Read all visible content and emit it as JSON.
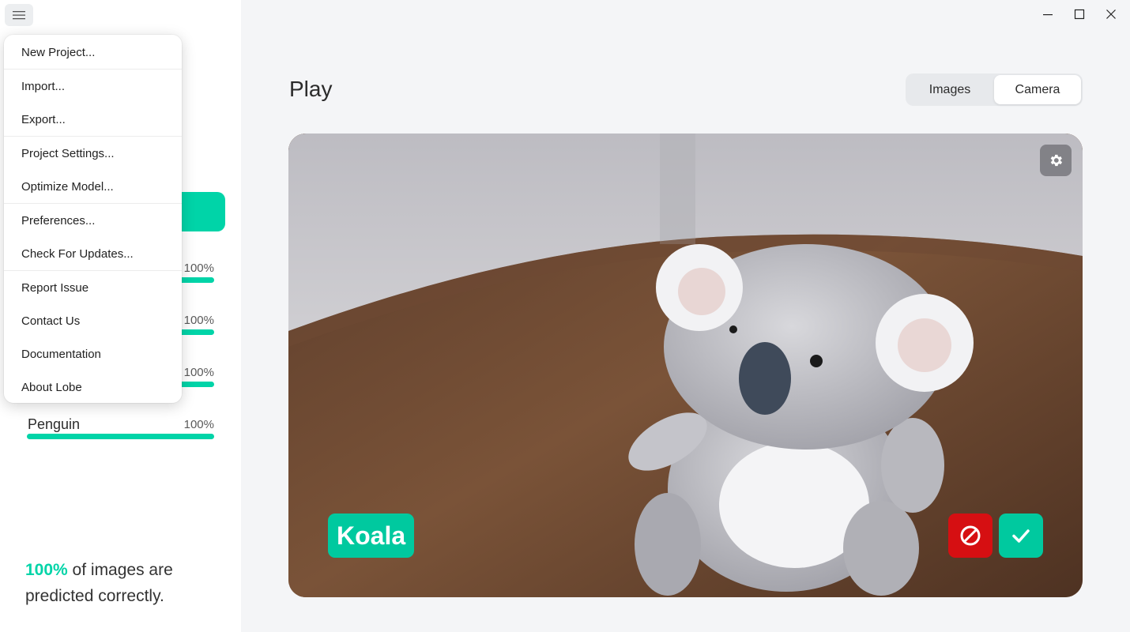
{
  "sidebar": {
    "labels": [
      {
        "name": "",
        "percent": "100%",
        "fill": 1.0
      },
      {
        "name": "",
        "percent": "100%",
        "fill": 1.0
      },
      {
        "name": "",
        "percent": "100%",
        "fill": 1.0
      },
      {
        "name": "Penguin",
        "percent": "100%",
        "fill": 1.0
      }
    ],
    "summary": {
      "percent": "100%",
      "line1_rest": " of images are",
      "line2": "predicted correctly."
    }
  },
  "menu": {
    "items": [
      {
        "label": "New Project..."
      },
      {
        "label": "Import..."
      },
      {
        "label": "Export..."
      },
      {
        "label": "Project Settings..."
      },
      {
        "label": "Optimize Model..."
      },
      {
        "label": "Preferences..."
      },
      {
        "label": "Check For Updates..."
      },
      {
        "label": "Report Issue"
      },
      {
        "label": "Contact Us"
      },
      {
        "label": "Documentation"
      },
      {
        "label": "About Lobe"
      }
    ]
  },
  "header": {
    "title": "Play",
    "tabs": [
      {
        "label": "Images",
        "selected": false
      },
      {
        "label": "Camera",
        "selected": true
      }
    ]
  },
  "camera": {
    "prediction": "Koala"
  },
  "colors": {
    "accent": "#00d4a8",
    "reject": "#d60f12"
  }
}
